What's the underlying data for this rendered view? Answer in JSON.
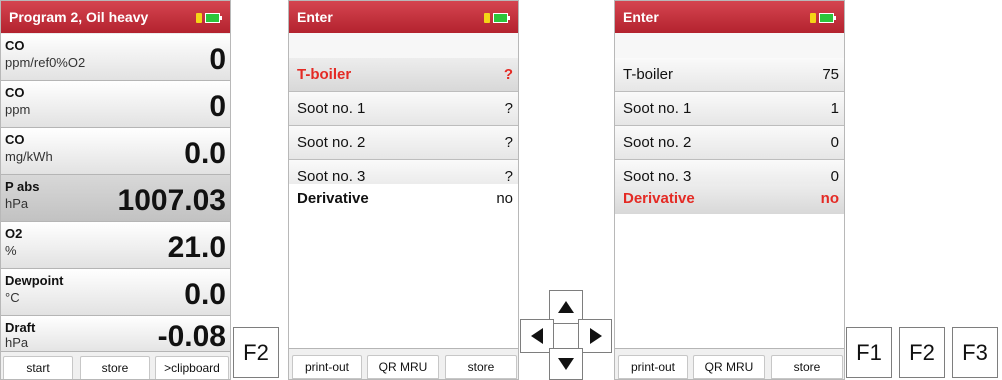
{
  "screen1": {
    "title": "Program 2, Oil heavy",
    "rows": [
      {
        "name": "CO",
        "unit": "ppm/ref0%O2",
        "value": "0"
      },
      {
        "name": "CO",
        "unit": "ppm",
        "value": "0"
      },
      {
        "name": "CO",
        "unit": "mg/kWh",
        "value": "0.0"
      },
      {
        "name": "P abs",
        "unit": "hPa",
        "value": "1007.03"
      },
      {
        "name": "O2",
        "unit": "%",
        "value": "21.0"
      },
      {
        "name": "Dewpoint",
        "unit": "°C",
        "value": "0.0"
      },
      {
        "name": "Draft",
        "unit": "hPa",
        "value": "-0.08"
      }
    ],
    "softkeys": [
      "start",
      "store",
      ">clipboard"
    ]
  },
  "key_f2_single": "F2",
  "screen2": {
    "title": "Enter",
    "rows": [
      {
        "label": "T-boiler",
        "value": "?"
      },
      {
        "label": "Soot no. 1",
        "value": "?"
      },
      {
        "label": "Soot no. 2",
        "value": "?"
      },
      {
        "label": "Soot no. 3",
        "value": "?"
      },
      {
        "label": "Derivative",
        "value": "no"
      }
    ],
    "softkeys": [
      "print-out",
      "QR MRU",
      "store"
    ]
  },
  "arrows": [
    "up-icon",
    "left-icon",
    "right-icon",
    "down-icon"
  ],
  "screen3": {
    "title": "Enter",
    "rows": [
      {
        "label": "T-boiler",
        "value": "75"
      },
      {
        "label": "Soot no. 1",
        "value": "1"
      },
      {
        "label": "Soot no. 2",
        "value": "0"
      },
      {
        "label": "Soot no. 3",
        "value": "0"
      },
      {
        "label": "Derivative",
        "value": "no"
      }
    ],
    "softkeys": [
      "print-out",
      "QR MRU",
      "store"
    ]
  },
  "fkeys": [
    "F1",
    "F2",
    "F3"
  ],
  "colors": {
    "titlebar": "#c12d39",
    "selected_text": "#e42a24",
    "battery": "#2cc53b"
  }
}
